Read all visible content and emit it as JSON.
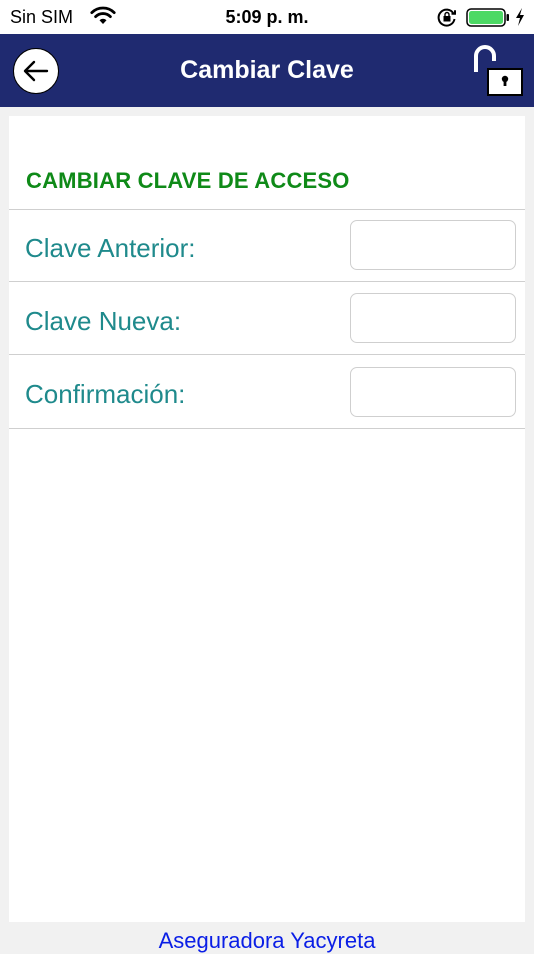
{
  "status_bar": {
    "carrier": "Sin SIM",
    "time": "5:09 p. m.",
    "battery_color": "#4cd964"
  },
  "nav": {
    "title": "Cambiar Clave",
    "background_color": "#1f2a70"
  },
  "form": {
    "section_title": "CAMBIAR CLAVE DE ACCESO",
    "fields": [
      {
        "label": "Clave Anterior:",
        "value": ""
      },
      {
        "label": "Clave Nueva:",
        "value": ""
      },
      {
        "label": "Confirmación:",
        "value": ""
      }
    ],
    "label_color": "#1f8a8c",
    "title_color": "#0f8a18"
  },
  "footer": {
    "text": "Aseguradora Yacyreta",
    "color": "#0a1ee6"
  },
  "icons": {
    "back": "arrow-left-icon",
    "lock": "unlocked-padlock-icon",
    "wifi": "wifi-icon",
    "rotation_lock": "rotation-lock-icon",
    "battery": "battery-icon",
    "charging": "charging-bolt-icon"
  }
}
